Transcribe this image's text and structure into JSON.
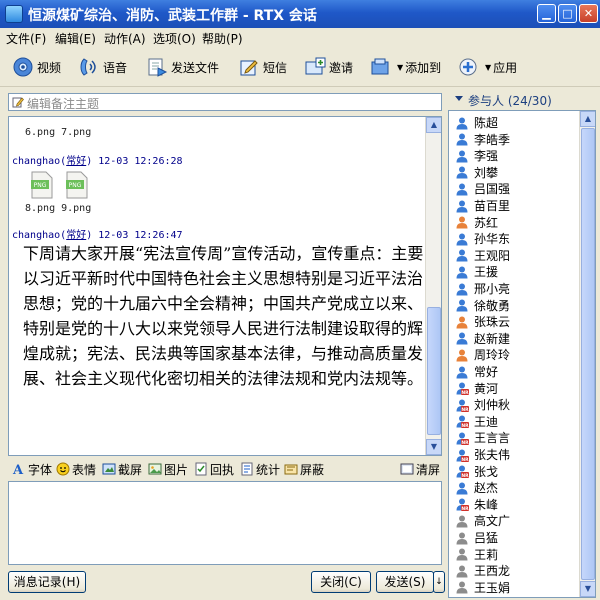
{
  "window": {
    "title": "恒源煤矿综治、消防、武装工作群 - RTX 会话",
    "min_icon": "minimize-icon",
    "max_icon": "maximize-icon",
    "close_icon": "close-icon"
  },
  "menu": [
    "文件(F)",
    "编辑(E)",
    "动作(A)",
    "选项(O)",
    "帮助(P)"
  ],
  "toolbar": [
    {
      "label": "视频",
      "icon": "video-icon"
    },
    {
      "label": "语音",
      "icon": "voice-icon"
    },
    {
      "label": "发送文件",
      "icon": "send-file-icon"
    },
    {
      "label": "短信",
      "icon": "sms-icon"
    },
    {
      "label": "邀请",
      "icon": "invite-icon"
    },
    {
      "label": "添加到",
      "icon": "add-to-icon"
    },
    {
      "label": "应用",
      "icon": "apps-icon"
    }
  ],
  "topic_placeholder": "编辑备注主题",
  "chat": {
    "files_row_1": "6.png 7.png",
    "msg1": {
      "sender": "changhao",
      "alias": "常好",
      "time": "12-03 12:26:28"
    },
    "files_row_2": "8.png 9.png",
    "msg2": {
      "sender": "changhao",
      "alias": "常好",
      "time": "12-03 12:26:47"
    },
    "msg2_text": "下周请大家开展“宪法宣传周”宣传活动，宣传重点：主要以习近平新时代中国特色社会主义思想特别是习近平法治思想；党的十九届六中全会精神；中国共产党成立以来、特别是党的十八大以来党领导人民进行法制建设取得的辉煌成就；宪法、民法典等国家基本法律，与推动高质量发展、社会主义现代化密切相关的法律法规和党内法规等。",
    "file_icon_text": "PNG"
  },
  "format_bar": {
    "font": "字体",
    "emoji": "表情",
    "screenshot": "截屏",
    "image": "图片",
    "receipt": "回执",
    "stats": "统计",
    "shield": "屏蔽",
    "clear": "清屏"
  },
  "buttons": {
    "history": "消息记录(H)",
    "close": "关闭(C)",
    "send": "发送(S)"
  },
  "participants": {
    "header": "参与人 (24/30)",
    "list": [
      {
        "name": "陈超",
        "status": "online"
      },
      {
        "name": "李皓季",
        "status": "online"
      },
      {
        "name": "李强",
        "status": "online"
      },
      {
        "name": "刘攀",
        "status": "online"
      },
      {
        "name": "吕国强",
        "status": "online"
      },
      {
        "name": "苗百里",
        "status": "online"
      },
      {
        "name": "苏红",
        "status": "female"
      },
      {
        "name": "孙华东",
        "status": "online"
      },
      {
        "name": "王观阳",
        "status": "online"
      },
      {
        "name": "王援",
        "status": "online"
      },
      {
        "name": "邢小亮",
        "status": "online"
      },
      {
        "name": "徐敬勇",
        "status": "online"
      },
      {
        "name": "张珠云",
        "status": "female"
      },
      {
        "name": "赵新建",
        "status": "online"
      },
      {
        "name": "周玲玲",
        "status": "female"
      },
      {
        "name": "常好",
        "status": "online"
      },
      {
        "name": "黄河",
        "status": "mobile"
      },
      {
        "name": "刘仲秋",
        "status": "mobile"
      },
      {
        "name": "王迪",
        "status": "mobile"
      },
      {
        "name": "王言言",
        "status": "mobile"
      },
      {
        "name": "张夫伟",
        "status": "mobile"
      },
      {
        "name": "张戈",
        "status": "mobile"
      },
      {
        "name": "赵杰",
        "status": "online"
      },
      {
        "name": "朱峰",
        "status": "mobile"
      },
      {
        "name": "高文广",
        "status": "offline"
      },
      {
        "name": "吕猛",
        "status": "offline"
      },
      {
        "name": "王莉",
        "status": "offline"
      },
      {
        "name": "王西龙",
        "status": "offline"
      },
      {
        "name": "王玉娟",
        "status": "offline"
      }
    ]
  },
  "colors": {
    "titlebar": "#1f58c8",
    "sender": "#00008b",
    "online": "#3a7bd5",
    "female": "#e8823a",
    "mobile_badge": "#d0302a",
    "offline": "#8c8c8c"
  }
}
